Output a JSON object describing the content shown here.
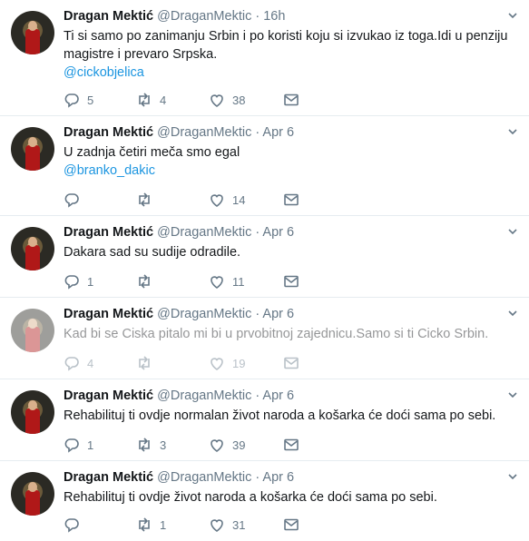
{
  "tweets": [
    {
      "name": "Dragan Mektić",
      "handle": "@DraganMektic",
      "time": "· 16h",
      "text": "Ti si samo po zanimanju Srbin i po koristi koju si izvukao iz toga.Idi u penziju magistre i prevaro Srpska.",
      "mention": "@cickobjelica",
      "replies": "5",
      "retweets": "4",
      "likes": "38"
    },
    {
      "name": "Dragan Mektić",
      "handle": "@DraganMektic",
      "time": "· Apr 6",
      "text": "U zadnja četiri meča smo egal",
      "mention": "@branko_dakic",
      "replies": "",
      "retweets": "",
      "likes": "14"
    },
    {
      "name": "Dragan Mektić",
      "handle": "@DraganMektic",
      "time": "· Apr 6",
      "text": "Dakara sad su sudije odradile.",
      "mention": "",
      "replies": "1",
      "retweets": "",
      "likes": "11"
    },
    {
      "name": "Dragan Mektić",
      "handle": "@DraganMektic",
      "time": "· Apr 6",
      "text": "Kad bi se Ciska pitalo mi bi u prvobitnoj zajednicu.Samo si ti Cicko Srbin.",
      "mention": "",
      "replies": "4",
      "retweets": "",
      "likes": "19"
    },
    {
      "name": "Dragan Mektić",
      "handle": "@DraganMektic",
      "time": "· Apr 6",
      "text": "Rehabilituj ti ovdje normalan život naroda a košarka će doći sama po sebi.",
      "mention": "",
      "replies": "1",
      "retweets": "3",
      "likes": "39"
    },
    {
      "name": "Dragan Mektić",
      "handle": "@DraganMektic",
      "time": "· Apr 6",
      "text": "Rehabilituj ti ovdje život naroda a košarka će doći sama po sebi.",
      "mention": "",
      "replies": "",
      "retweets": "1",
      "likes": "31"
    }
  ]
}
